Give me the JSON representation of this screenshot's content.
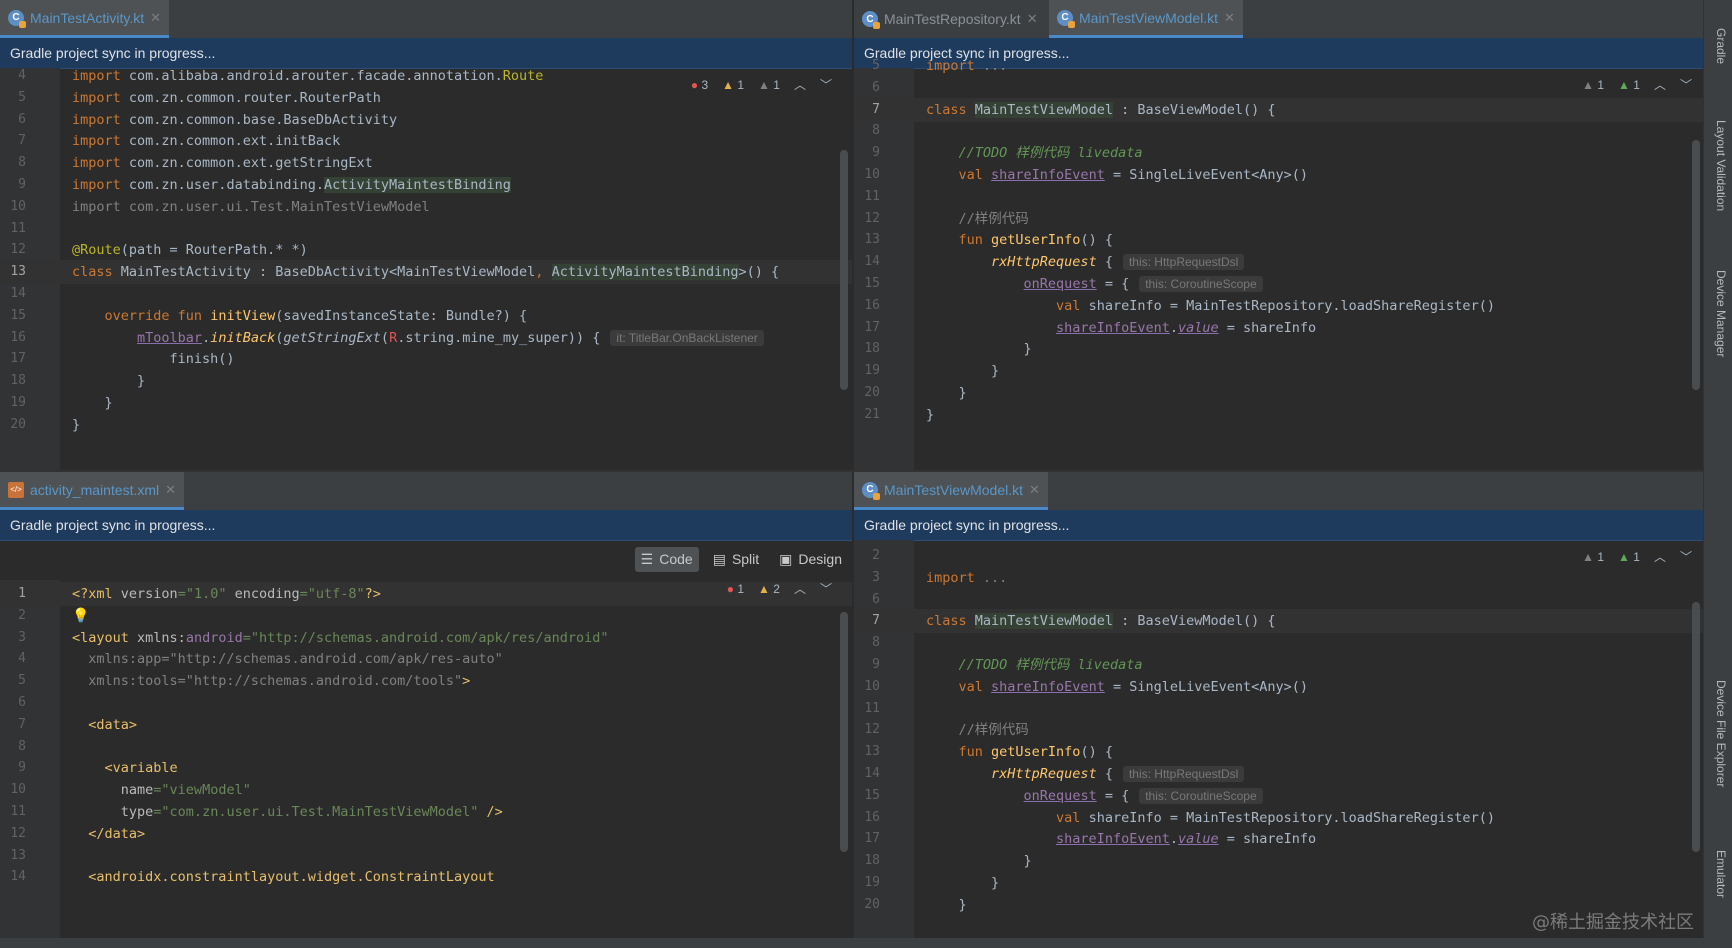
{
  "banner_text": "Gradle project sync in progress...",
  "right_toolwindows": [
    "Gradle",
    "Layout Validation",
    "Device Manager",
    "Device File Explorer",
    "Emulator"
  ],
  "watermark": "@稀土掘金技术社区",
  "pane_tl": {
    "tab": "MainTestActivity.kt",
    "inspections": {
      "errors": "3",
      "warnings": "1",
      "weak": "1"
    },
    "lines": [
      {
        "n": "4",
        "parts": [
          [
            "kw",
            "import "
          ],
          [
            "pkg",
            "com.alibaba.android.arouter.facade.annotation."
          ],
          [
            "ann",
            "Route"
          ]
        ]
      },
      {
        "n": "5",
        "parts": [
          [
            "kw",
            "import "
          ],
          [
            "pkg",
            "com.zn.common.router.RouterPath"
          ]
        ]
      },
      {
        "n": "6",
        "parts": [
          [
            "kw",
            "import "
          ],
          [
            "pkg",
            "com.zn.common.base.BaseDbActivity"
          ]
        ]
      },
      {
        "n": "7",
        "parts": [
          [
            "kw",
            "import "
          ],
          [
            "pkg",
            "com.zn.common.ext.initBack"
          ]
        ]
      },
      {
        "n": "8",
        "parts": [
          [
            "kw",
            "import "
          ],
          [
            "pkg",
            "com.zn.common.ext.getStringExt"
          ]
        ]
      },
      {
        "n": "9",
        "parts": [
          [
            "kw",
            "import "
          ],
          [
            "pkg",
            "com.zn.user.databinding."
          ],
          [
            "hl",
            "ActivityMaintestBinding"
          ]
        ]
      },
      {
        "n": "10",
        "parts": [
          [
            "gr",
            "import com.zn.user.ui.Test.MainTestViewModel"
          ]
        ]
      },
      {
        "n": "11",
        "parts": []
      },
      {
        "n": "12",
        "parts": [
          [
            "ann",
            "@Route"
          ],
          [
            "pkg",
            "(path = RouterPath.* *)"
          ]
        ]
      },
      {
        "n": "13",
        "parts": [
          [
            "kw",
            "class "
          ],
          [
            "pkg",
            "MainTestActivity : BaseDbActivity<MainTestViewModel"
          ],
          [
            "kw",
            ", "
          ],
          [
            "hl",
            "ActivityMaintestBinding"
          ],
          [
            "pkg",
            ">() {"
          ]
        ]
      },
      {
        "n": "14",
        "parts": []
      },
      {
        "n": "15",
        "parts": [
          [
            "pkg",
            "    "
          ],
          [
            "kw",
            "override fun "
          ],
          [
            "fn",
            "initView"
          ],
          [
            "pkg",
            "(savedInstanceState: Bundle?) {"
          ]
        ]
      },
      {
        "n": "16",
        "parts": [
          [
            "pkg",
            "        "
          ],
          [
            "propul",
            "mToolbar"
          ],
          [
            "pkg",
            "."
          ],
          [
            "fnit",
            "initBack"
          ],
          [
            "pkg",
            "("
          ],
          [
            "it",
            "getStringExt"
          ],
          [
            "pkg",
            "("
          ],
          [
            "err",
            "R"
          ],
          [
            "pkg",
            ".string.mine_my_super)) {"
          ],
          [
            "hint",
            "it: TitleBar.OnBackListener"
          ]
        ]
      },
      {
        "n": "17",
        "parts": [
          [
            "pkg",
            "            finish()"
          ]
        ]
      },
      {
        "n": "18",
        "parts": [
          [
            "pkg",
            "        }"
          ]
        ]
      },
      {
        "n": "19",
        "parts": [
          [
            "pkg",
            "    }"
          ]
        ]
      },
      {
        "n": "20",
        "parts": [
          [
            "pkg",
            "}"
          ]
        ]
      }
    ]
  },
  "pane_tr": {
    "tabs": [
      "MainTestRepository.kt",
      "MainTestViewModel.kt"
    ],
    "inspections": {
      "warnings": "1",
      "weak": "1"
    },
    "lines": [
      {
        "n": "5",
        "parts": [
          [
            "kw",
            "import "
          ],
          [
            "gr",
            "..."
          ]
        ]
      },
      {
        "n": "6",
        "parts": []
      },
      {
        "n": "7",
        "parts": [
          [
            "kw",
            "class "
          ],
          [
            "hl",
            "MainTestViewModel"
          ],
          [
            "pkg",
            " : BaseViewModel() {"
          ]
        ]
      },
      {
        "n": "8",
        "parts": []
      },
      {
        "n": "9",
        "parts": [
          [
            "pkg",
            "    "
          ],
          [
            "cm",
            "//TODO 样例代码 livedata"
          ]
        ]
      },
      {
        "n": "10",
        "parts": [
          [
            "pkg",
            "    "
          ],
          [
            "kw",
            "val "
          ],
          [
            "propul",
            "shareInfoEvent"
          ],
          [
            "pkg",
            " = SingleLiveEvent<Any>()"
          ]
        ]
      },
      {
        "n": "11",
        "parts": []
      },
      {
        "n": "12",
        "parts": [
          [
            "pkg",
            "    "
          ],
          [
            "gr",
            "//样例代码"
          ]
        ]
      },
      {
        "n": "13",
        "parts": [
          [
            "pkg",
            "    "
          ],
          [
            "kw",
            "fun "
          ],
          [
            "fn",
            "getUserInfo"
          ],
          [
            "pkg",
            "() {"
          ]
        ]
      },
      {
        "n": "14",
        "parts": [
          [
            "pkg",
            "        "
          ],
          [
            "fnit",
            "rxHttpRequest"
          ],
          [
            "pkg",
            " {"
          ],
          [
            "hint",
            "this: HttpRequestDsl"
          ]
        ]
      },
      {
        "n": "15",
        "parts": [
          [
            "pkg",
            "            "
          ],
          [
            "propul",
            "onRequest"
          ],
          [
            "pkg",
            " = {"
          ],
          [
            "hint",
            "this: CoroutineScope"
          ]
        ]
      },
      {
        "n": "16",
        "parts": [
          [
            "pkg",
            "                "
          ],
          [
            "kw",
            "val "
          ],
          [
            "pkg",
            "shareInfo = MainTestRepository.loadShareRegister()"
          ]
        ]
      },
      {
        "n": "17",
        "parts": [
          [
            "pkg",
            "                "
          ],
          [
            "propul2",
            "shareInfoEvent"
          ],
          [
            "pkg",
            "."
          ],
          [
            "propit",
            "value"
          ],
          [
            "pkg",
            " = shareInfo"
          ]
        ]
      },
      {
        "n": "18",
        "parts": [
          [
            "pkg",
            "            }"
          ]
        ]
      },
      {
        "n": "19",
        "parts": [
          [
            "pkg",
            "        }"
          ]
        ]
      },
      {
        "n": "20",
        "parts": [
          [
            "pkg",
            "    }"
          ]
        ]
      },
      {
        "n": "21",
        "parts": [
          [
            "pkg",
            "}"
          ]
        ]
      }
    ]
  },
  "pane_bl": {
    "tab": "activity_maintest.xml",
    "inspections": {
      "errors": "1",
      "warnings": "2"
    },
    "toolbar": {
      "code": "Code",
      "split": "Split",
      "design": "Design"
    },
    "lines": [
      {
        "n": "1",
        "parts": [
          [
            "tag",
            "<?xml "
          ],
          [
            "attr",
            "version"
          ],
          [
            "str",
            "=\"1.0\" "
          ],
          [
            "attr",
            "encoding"
          ],
          [
            "str",
            "=\"utf-8\""
          ],
          [
            "tag",
            "?>"
          ]
        ]
      },
      {
        "n": "2",
        "parts": [
          [
            "bulb",
            "💡"
          ]
        ]
      },
      {
        "n": "3",
        "parts": [
          [
            "tag",
            "<layout "
          ],
          [
            "attr",
            "xmlns:"
          ],
          [
            "xmlns",
            "android"
          ],
          [
            "str",
            "=\"http://schemas.android.com/apk/res/android\""
          ]
        ]
      },
      {
        "n": "4",
        "parts": [
          [
            "gr",
            "  xmlns:app=\"http://schemas.android.com/apk/res-auto\""
          ]
        ]
      },
      {
        "n": "5",
        "parts": [
          [
            "gr",
            "  xmlns:tools=\"http://schemas.android.com/tools\""
          ],
          [
            "tag",
            ">"
          ]
        ]
      },
      {
        "n": "6",
        "parts": []
      },
      {
        "n": "7",
        "parts": [
          [
            "pkg",
            "  "
          ],
          [
            "tag",
            "<data>"
          ]
        ]
      },
      {
        "n": "8",
        "parts": []
      },
      {
        "n": "9",
        "parts": [
          [
            "pkg",
            "    "
          ],
          [
            "tag",
            "<variable"
          ]
        ]
      },
      {
        "n": "10",
        "parts": [
          [
            "pkg",
            "      "
          ],
          [
            "attr",
            "name"
          ],
          [
            "str",
            "=\"viewModel\""
          ]
        ]
      },
      {
        "n": "11",
        "parts": [
          [
            "pkg",
            "      "
          ],
          [
            "attr",
            "type"
          ],
          [
            "str",
            "=\"com.zn.user.ui.Test.MainTestViewModel\""
          ],
          [
            "tag",
            " />"
          ]
        ]
      },
      {
        "n": "12",
        "parts": [
          [
            "pkg",
            "  "
          ],
          [
            "tag",
            "</data>"
          ]
        ]
      },
      {
        "n": "13",
        "parts": []
      },
      {
        "n": "14",
        "parts": [
          [
            "pkg",
            "  "
          ],
          [
            "tag",
            "<androidx.constraintlayout.widget.ConstraintLayout"
          ]
        ]
      }
    ]
  },
  "pane_br": {
    "tab": "MainTestViewModel.kt",
    "inspections": {
      "warnings": "1",
      "weak": "1"
    },
    "lines": [
      {
        "n": "2",
        "parts": []
      },
      {
        "n": "3",
        "parts": [
          [
            "kw",
            "import "
          ],
          [
            "gr",
            "..."
          ]
        ]
      },
      {
        "n": "6",
        "parts": []
      },
      {
        "n": "7",
        "parts": [
          [
            "kw",
            "class "
          ],
          [
            "hl",
            "MainTestViewModel"
          ],
          [
            "pkg",
            " : BaseViewModel() {"
          ]
        ]
      },
      {
        "n": "8",
        "parts": []
      },
      {
        "n": "9",
        "parts": [
          [
            "pkg",
            "    "
          ],
          [
            "cm",
            "//TODO 样例代码 livedata"
          ]
        ]
      },
      {
        "n": "10",
        "parts": [
          [
            "pkg",
            "    "
          ],
          [
            "kw",
            "val "
          ],
          [
            "propul",
            "shareInfoEvent"
          ],
          [
            "pkg",
            " = SingleLiveEvent<Any>()"
          ]
        ]
      },
      {
        "n": "11",
        "parts": []
      },
      {
        "n": "12",
        "parts": [
          [
            "pkg",
            "    "
          ],
          [
            "gr",
            "//样例代码"
          ]
        ]
      },
      {
        "n": "13",
        "parts": [
          [
            "pkg",
            "    "
          ],
          [
            "kw",
            "fun "
          ],
          [
            "fn",
            "getUserInfo"
          ],
          [
            "pkg",
            "() {"
          ]
        ]
      },
      {
        "n": "14",
        "parts": [
          [
            "pkg",
            "        "
          ],
          [
            "fnit",
            "rxHttpRequest"
          ],
          [
            "pkg",
            " {"
          ],
          [
            "hint",
            "this: HttpRequestDsl"
          ]
        ]
      },
      {
        "n": "15",
        "parts": [
          [
            "pkg",
            "            "
          ],
          [
            "propul",
            "onRequest"
          ],
          [
            "pkg",
            " = {"
          ],
          [
            "hint",
            "this: CoroutineScope"
          ]
        ]
      },
      {
        "n": "16",
        "parts": [
          [
            "pkg",
            "                "
          ],
          [
            "kw",
            "val "
          ],
          [
            "pkg",
            "shareInfo = MainTestRepository.loadShareRegister()"
          ]
        ]
      },
      {
        "n": "17",
        "parts": [
          [
            "pkg",
            "                "
          ],
          [
            "propul2",
            "shareInfoEvent"
          ],
          [
            "pkg",
            "."
          ],
          [
            "propit",
            "value"
          ],
          [
            "pkg",
            " = shareInfo"
          ]
        ]
      },
      {
        "n": "18",
        "parts": [
          [
            "pkg",
            "            }"
          ]
        ]
      },
      {
        "n": "19",
        "parts": [
          [
            "pkg",
            "        }"
          ]
        ]
      },
      {
        "n": "20",
        "parts": [
          [
            "pkg",
            "    }"
          ]
        ]
      }
    ]
  }
}
